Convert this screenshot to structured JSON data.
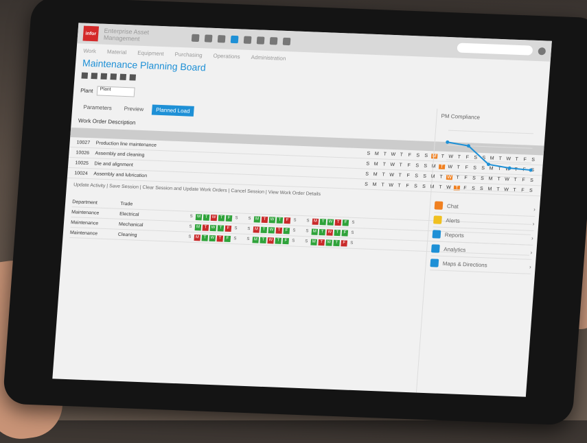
{
  "app": {
    "logo_text": "infor",
    "title": "Enterprise Asset Management"
  },
  "menu": [
    "Work",
    "Material",
    "Equipment",
    "Purchasing",
    "Operations",
    "Administration"
  ],
  "page": {
    "title": "Maintenance Planning Board",
    "field_label": "Plant",
    "field_value": "Plant"
  },
  "tabs": [
    "Parameters",
    "Preview",
    "Planned Load"
  ],
  "section_label": "Work Order  Description",
  "grid": {
    "rows": [
      {
        "id": "10027",
        "desc": "Production line maintenance"
      },
      {
        "id": "10026",
        "desc": "Assembly and cleaning"
      },
      {
        "id": "10025",
        "desc": "Die and alignment"
      },
      {
        "id": "10024",
        "desc": "Assembly and lubrication"
      }
    ],
    "day_letters": [
      "S",
      "M",
      "T",
      "W",
      "T",
      "F",
      "S"
    ]
  },
  "links": "Update Activity | Save Session | Clear Session and Update Work Orders | Cancel Session | View Work Order Details",
  "crew": {
    "header": {
      "dep": "Department",
      "trade": "Trade"
    },
    "rows": [
      {
        "dep": "Maintenance",
        "trade": "Electrical"
      },
      {
        "dep": "Maintenance",
        "trade": "Mechanical"
      },
      {
        "dep": "Maintenance",
        "trade": "Cleaning"
      }
    ]
  },
  "right_panel": {
    "chart_title": "PM Compliance",
    "items": [
      "Chat",
      "Alerts",
      "Reports",
      "Analytics",
      "Maps & Directions"
    ]
  },
  "chart_data": {
    "type": "line",
    "values": [
      0.8,
      0.75,
      0.45,
      0.4,
      0.38
    ],
    "categories": [
      "",
      "",
      "",
      "",
      ""
    ]
  }
}
